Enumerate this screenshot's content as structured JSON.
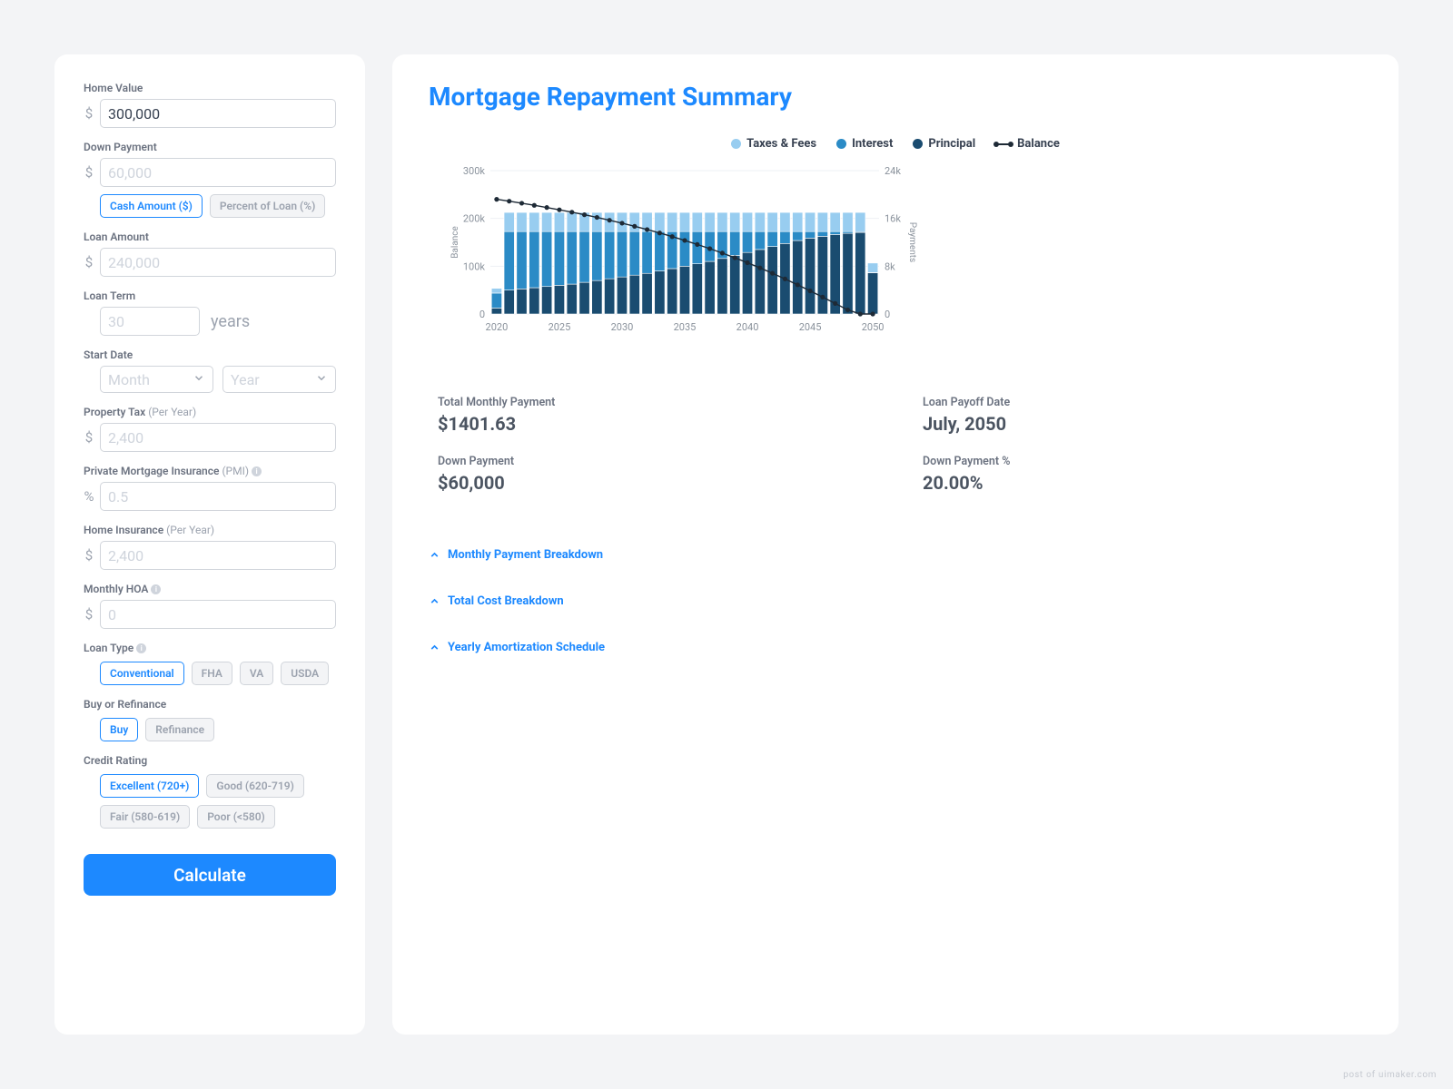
{
  "form": {
    "home_value": {
      "label": "Home Value",
      "value": "300,000",
      "prefix": "$"
    },
    "down_payment": {
      "label": "Down Payment",
      "placeholder": "60,000",
      "prefix": "$"
    },
    "down_payment_mode": {
      "options": [
        "Cash Amount ($)",
        "Percent of Loan (%)"
      ],
      "active": 0
    },
    "loan_amount": {
      "label": "Loan Amount",
      "placeholder": "240,000",
      "prefix": "$"
    },
    "loan_term": {
      "label": "Loan Term",
      "placeholder": "30",
      "suffix": "years"
    },
    "start_date": {
      "label": "Start Date",
      "month_placeholder": "Month",
      "year_placeholder": "Year"
    },
    "property_tax": {
      "label": "Property Tax",
      "sub": "(Per Year)",
      "placeholder": "2,400",
      "prefix": "$"
    },
    "pmi": {
      "label": "Private Mortgage Insurance",
      "sub": "(PMI)",
      "placeholder": "0.5",
      "prefix": "%"
    },
    "home_insurance": {
      "label": "Home Insurance",
      "sub": "(Per Year)",
      "placeholder": "2,400",
      "prefix": "$"
    },
    "hoa": {
      "label": "Monthly HOA",
      "placeholder": "0",
      "prefix": "$"
    },
    "loan_type": {
      "label": "Loan Type",
      "options": [
        "Conventional",
        "FHA",
        "VA",
        "USDA"
      ],
      "active": 0
    },
    "buy_refi": {
      "label": "Buy or Refinance",
      "options": [
        "Buy",
        "Refinance"
      ],
      "active": 0
    },
    "credit_rating": {
      "label": "Credit Rating",
      "options": [
        "Excellent (720+)",
        "Good (620-719)",
        "Fair (580-619)",
        "Poor (<580)"
      ],
      "active": 0
    },
    "calculate_label": "Calculate"
  },
  "summary": {
    "title": "Mortgage Repayment Summary",
    "legend": {
      "taxes": "Taxes & Fees",
      "interest": "Interest",
      "principal": "Principal",
      "balance": "Balance"
    },
    "kpis": [
      {
        "label": "Total Monthly Payment",
        "value": "$1401.63"
      },
      {
        "label": "Loan Payoff Date",
        "value": "July, 2050"
      },
      {
        "label": "Down Payment",
        "value": "$60,000"
      },
      {
        "label": "Down Payment %",
        "value": "20.00%"
      }
    ],
    "accordion": [
      "Monthly Payment Breakdown",
      "Total Cost Breakdown",
      "Yearly Amortization Schedule"
    ]
  },
  "chart_data": {
    "type": "bar",
    "title": "Mortgage Repayment Summary",
    "xlabel": "",
    "ylabel_left": "Balance",
    "ylabel_right": "Payments",
    "categories": [
      2020,
      2021,
      2022,
      2023,
      2024,
      2025,
      2026,
      2027,
      2028,
      2029,
      2030,
      2031,
      2032,
      2033,
      2034,
      2035,
      2036,
      2037,
      2038,
      2039,
      2040,
      2041,
      2042,
      2043,
      2044,
      2045,
      2046,
      2047,
      2048,
      2049,
      2050
    ],
    "y_left_ticks": [
      0,
      100000,
      200000,
      300000
    ],
    "y_left_tick_labels": [
      "0",
      "100k",
      "200k",
      "300k"
    ],
    "y_right_ticks": [
      0,
      8000,
      16000,
      24000
    ],
    "y_right_tick_labels": [
      "0",
      "8k",
      "16k",
      "24k"
    ],
    "x_tick_labels": [
      "2020",
      "2025",
      "2030",
      "2035",
      "2040",
      "2045",
      "2050"
    ],
    "ylim_left": [
      0,
      300000
    ],
    "ylim_right": [
      0,
      24000
    ],
    "series": [
      {
        "name": "Taxes & Fees",
        "axis": "right",
        "color": "#98cdf0",
        "values": [
          800,
          3200,
          3200,
          3200,
          3200,
          3200,
          3200,
          3200,
          3200,
          3200,
          3200,
          3200,
          3200,
          3200,
          3200,
          3200,
          3200,
          3200,
          3200,
          3200,
          3200,
          3200,
          3200,
          3200,
          3200,
          3200,
          3200,
          3200,
          3200,
          3200,
          1600
        ]
      },
      {
        "name": "Interest",
        "axis": "right",
        "color": "#2b8bc6",
        "values": [
          2500,
          9800,
          9600,
          9400,
          9200,
          9000,
          8800,
          8500,
          8200,
          7900,
          7600,
          7300,
          7000,
          6600,
          6200,
          5800,
          5400,
          5000,
          4500,
          4000,
          3500,
          3000,
          2500,
          2000,
          1500,
          1100,
          800,
          500,
          300,
          150,
          30
        ]
      },
      {
        "name": "Principal",
        "axis": "right",
        "color": "#1a4c70",
        "values": [
          1000,
          4000,
          4200,
          4400,
          4600,
          4800,
          5000,
          5300,
          5600,
          5900,
          6200,
          6500,
          6800,
          7200,
          7600,
          8000,
          8400,
          8800,
          9300,
          9800,
          10300,
          10800,
          11300,
          11800,
          12300,
          12700,
          13000,
          13300,
          13500,
          13650,
          6900
        ]
      },
      {
        "name": "Balance",
        "axis": "left",
        "type": "line",
        "color": "#1e2a36",
        "values": [
          240000,
          236000,
          231800,
          227400,
          222800,
          218000,
          213000,
          207700,
          202100,
          196200,
          190000,
          183500,
          176700,
          169500,
          161900,
          153900,
          145500,
          136700,
          127400,
          117600,
          107300,
          96500,
          85200,
          73400,
          61100,
          48400,
          35400,
          22100,
          8600,
          0,
          0
        ]
      }
    ]
  },
  "footer": "post of uimaker.com"
}
